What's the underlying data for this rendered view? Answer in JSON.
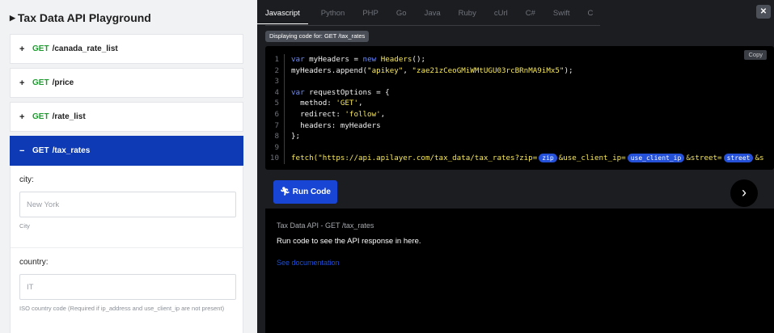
{
  "sidebar": {
    "title": "Tax Data API Playground",
    "endpoints": [
      {
        "sign": "+",
        "method": "GET",
        "path": "/canada_rate_list"
      },
      {
        "sign": "+",
        "method": "GET",
        "path": "/price"
      },
      {
        "sign": "+",
        "method": "GET",
        "path": "/rate_list"
      },
      {
        "sign": "−",
        "method": "GET",
        "path": "/tax_rates"
      }
    ],
    "params": [
      {
        "label": "city:",
        "placeholder": "New York",
        "help": "City"
      },
      {
        "label": "country:",
        "placeholder": "IT",
        "help": "ISO country code (Required if ip_address and use_client_ip are not present)"
      }
    ]
  },
  "tabs": [
    "Javascript",
    "Python",
    "PHP",
    "Go",
    "Java",
    "Ruby",
    "cUrl",
    "C#",
    "Swift",
    "C"
  ],
  "display_label": "Displaying code for: GET /tax_rates",
  "copy_label": "Copy",
  "code": {
    "line_numbers": [
      "1",
      "2",
      "3",
      "4",
      "5",
      "6",
      "7",
      "8",
      "9",
      "10"
    ],
    "l1a": "var",
    "l1b": " myHeaders = ",
    "l1c": "new",
    "l1d": " ",
    "l1e": "Headers",
    "l1f": "();",
    "l2a": "myHeaders.append(",
    "l2b": "\"apikey\"",
    "l2c": ", ",
    "l2d": "\"zae21zCeoGMiWMtUGU03rcBRnMA9iMx5\"",
    "l2e": ");",
    "l4a": "var",
    "l4b": " requestOptions = {",
    "l5a": "  method: ",
    "l5b": "'GET'",
    "l5c": ",",
    "l6a": "  redirect: ",
    "l6b": "'follow'",
    "l6c": ",",
    "l7a": "  headers: myHeaders",
    "l8a": "};",
    "l10a": "fetch(",
    "l10b": "\"https://api.apilayer.com/tax_data/tax_rates?zip=",
    "l10p1": "zip",
    "l10c": "&use_client_ip=",
    "l10p2": "use_client_ip",
    "l10d": "&street=",
    "l10p3": "street",
    "l10e": "&s"
  },
  "run_label": "Run Code",
  "response": {
    "title": "Tax Data API - GET /tax_rates",
    "message": "Run code to see the API response in here.",
    "link": "See documentation"
  },
  "colors": {
    "accent_blue": "#0e3bb5",
    "method_green": "#1a9d2c",
    "keyword_blue": "#6b8cff",
    "string_yellow": "#f5e65a"
  },
  "icons": {
    "close": "close-icon",
    "next": "chevron-right-icon",
    "run": "runner-icon",
    "title_caret": "caret-right-icon"
  }
}
